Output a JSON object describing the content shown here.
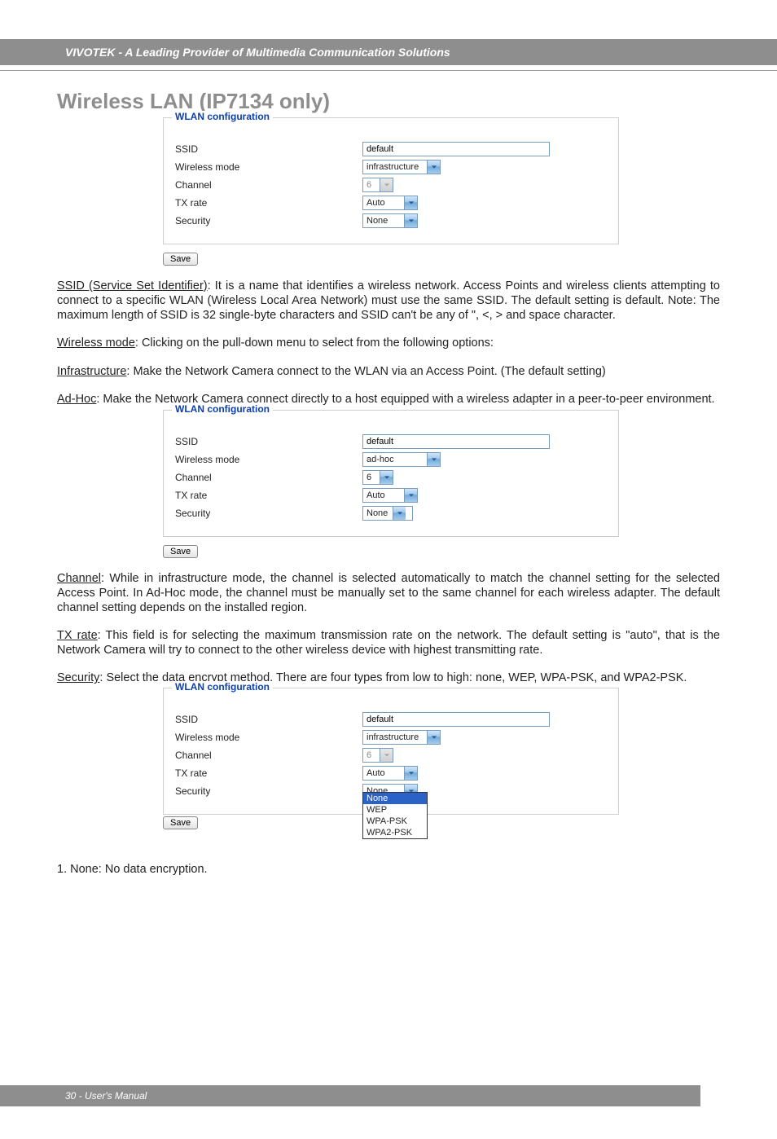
{
  "header": {
    "brand": "VIVOTEK - A Leading Provider of Multimedia Communication Solutions"
  },
  "title": "Wireless LAN (IP7134 only)",
  "wlan": {
    "legend": "WLAN configuration",
    "labels": {
      "ssid": "SSID",
      "wireless_mode": "Wireless mode",
      "channel": "Channel",
      "tx_rate": "TX rate",
      "security": "Security"
    },
    "save": "Save"
  },
  "panel1": {
    "ssid": "default",
    "wireless_mode": "infrastructure",
    "channel": "6",
    "tx_rate": "Auto",
    "security": "None"
  },
  "panel2": {
    "ssid": "default",
    "wireless_mode": "ad-hoc",
    "channel": "6",
    "tx_rate": "Auto",
    "security": "None"
  },
  "panel3": {
    "ssid": "default",
    "wireless_mode": "infrastructure",
    "channel": "6",
    "tx_rate": "Auto",
    "security": "None",
    "security_options": [
      "None",
      "WEP",
      "WPA-PSK",
      "WPA2-PSK"
    ]
  },
  "text": {
    "ssid_label": "SSID (Service Set Identifier)",
    "ssid_body": ": It is a name that identifies a wireless network. Access Points and wireless clients attempting to connect to a specific WLAN (Wireless Local Area Network) must use the same SSID. The default setting is default. Note: The maximum length of SSID is 32 single-byte characters and SSID can't be any of \", <, > and space character.",
    "wmode_label": "Wireless mode",
    "wmode_body": ": Clicking on the pull-down menu to select from the following options:",
    "infra_label": "Infrastructure",
    "infra_body": ": Make the Network Camera connect to the WLAN via an Access Point. (The default setting)",
    "adhoc_label": "Ad-Hoc",
    "adhoc_body": ": Make the Network Camera connect directly to a host equipped with a wireless adapter in a peer-to-peer environment.",
    "channel_label": "Channel",
    "channel_body": ": While in infrastructure mode, the channel is selected automatically to match the channel setting for the selected Access Point. In Ad-Hoc mode, the channel must be manually set to the same channel for each wireless adapter. The default channel setting depends on the installed region.",
    "txrate_label": "TX rate",
    "txrate_body": ": This field is for selecting the maximum transmission rate on the network. The default setting is \"auto\", that is the Network Camera will try to connect to the other wireless device with highest transmitting rate.",
    "security_label": "Security",
    "security_body": ": Select the data encrypt method. There are four types from low to high: none, WEP, WPA-PSK, and WPA2-PSK.",
    "item1": "1. None: No data encryption."
  },
  "footer": {
    "text": "30 - User's Manual"
  }
}
